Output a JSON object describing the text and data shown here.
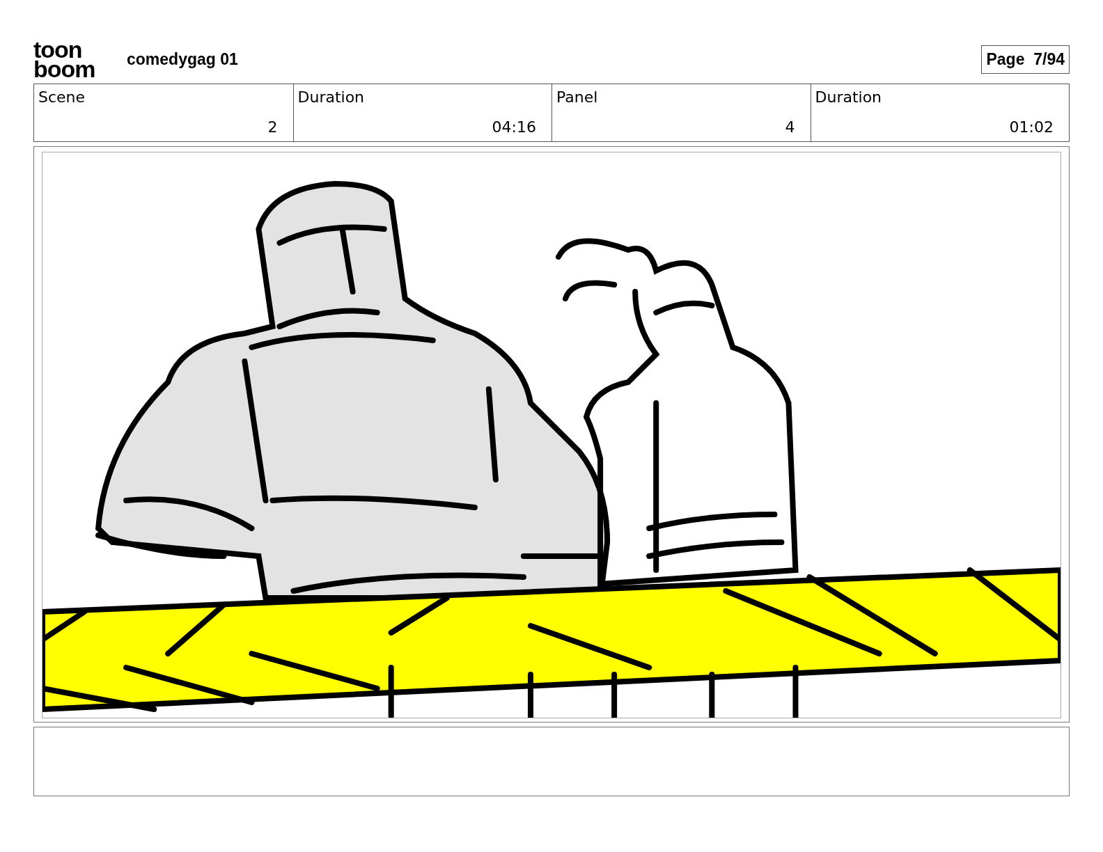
{
  "header": {
    "logo": {
      "top": "toon",
      "bottom": "boom"
    },
    "project_title": "comedygag 01",
    "page": "Page  7/94"
  },
  "info_table": [
    {
      "label": "Scene",
      "value": "2"
    },
    {
      "label": "Duration",
      "value": "04:16"
    },
    {
      "label": "Panel",
      "value": "4"
    },
    {
      "label": "Duration",
      "value": "01:02"
    }
  ]
}
